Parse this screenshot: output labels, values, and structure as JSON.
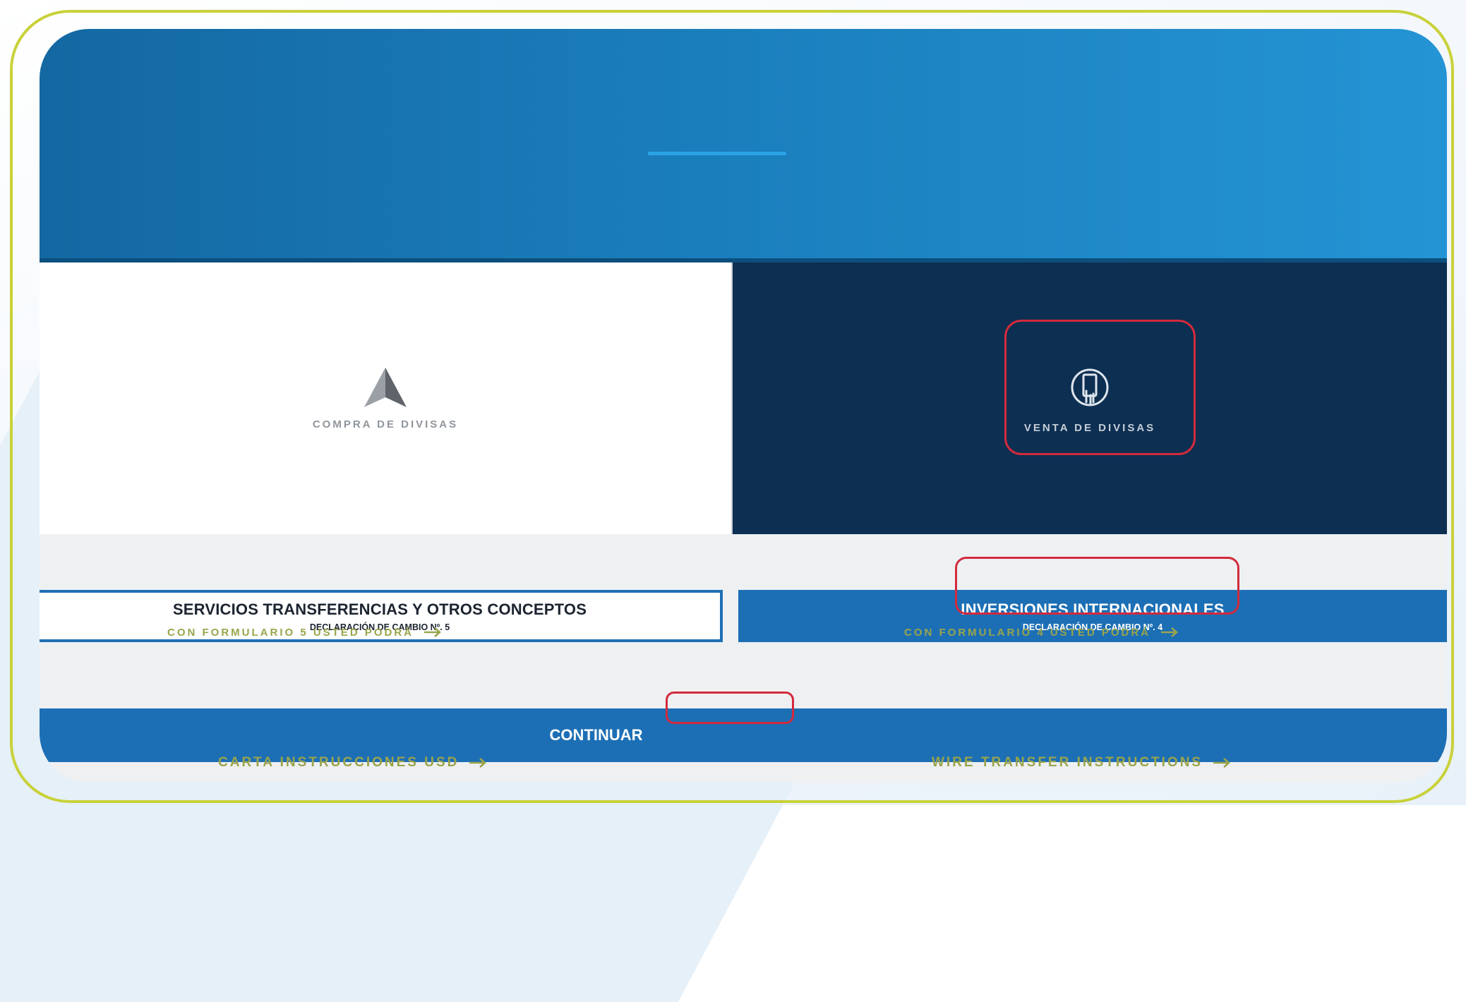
{
  "tiles": {
    "buy": {
      "label": "COMPRA DE DIVISAS",
      "icon": "triangle-icon"
    },
    "sell": {
      "label": "VENTA DE DIVISAS",
      "icon": "hand-phone-icon",
      "highlighted": true
    }
  },
  "options": {
    "services": {
      "title": "SERVICIOS TRANSFERENCIAS Y OTROS CONCEPTOS",
      "subtitle": "DECLARACIÓN DE CAMBIO Nº. 5",
      "link": "CON FORMULARIO 5 USTED PODRÁ"
    },
    "investments": {
      "title": "INVERSIONES INTERNACIONALES",
      "subtitle": "DECLARACIÓN DE CAMBIO Nº. 4",
      "link": "CON FORMULARIO 4 USTED PODRÁ",
      "highlighted": true
    }
  },
  "continue_label": "CONTINUAR",
  "footer": {
    "usd_link": "CARTA INSTRUCCIONES USD",
    "wire_link": "WIRE TRANSFER INSTRUCTIONS"
  },
  "colors": {
    "frame": "#c9d13a",
    "banner": "#1a7dbb",
    "sell_tile": "#0d2f52",
    "primary_blue": "#1d6fb5",
    "highlight_red": "#d32a3c",
    "link_olive": "#9aa44a"
  }
}
